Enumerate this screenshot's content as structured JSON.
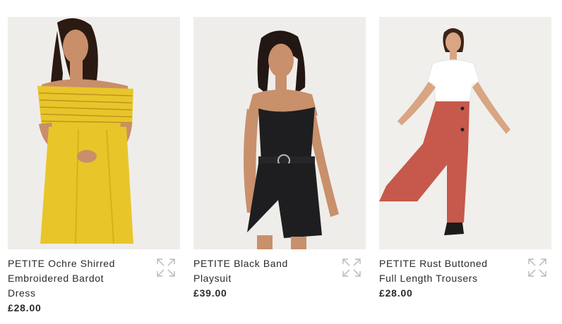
{
  "products": [
    {
      "name": "PETITE Ochre Shirred Embroidered Bardot Dress",
      "price": "£28.00",
      "image_icon": "product-photo-yellow-dress",
      "expand_icon": "expand-icon",
      "colors": {
        "garment": "#e8c62a",
        "background": "#efedea"
      }
    },
    {
      "name": "PETITE Black Band Playsuit",
      "price": "£39.00",
      "image_icon": "product-photo-black-playsuit",
      "expand_icon": "expand-icon",
      "colors": {
        "garment": "#1e1e20",
        "background": "#efedea"
      }
    },
    {
      "name": "PETITE Rust Buttoned Full Length Trousers",
      "price": "£28.00",
      "image_icon": "product-photo-rust-trousers",
      "expand_icon": "expand-icon",
      "colors": {
        "garment": "#c6594b",
        "background": "#f0efec"
      }
    }
  ]
}
